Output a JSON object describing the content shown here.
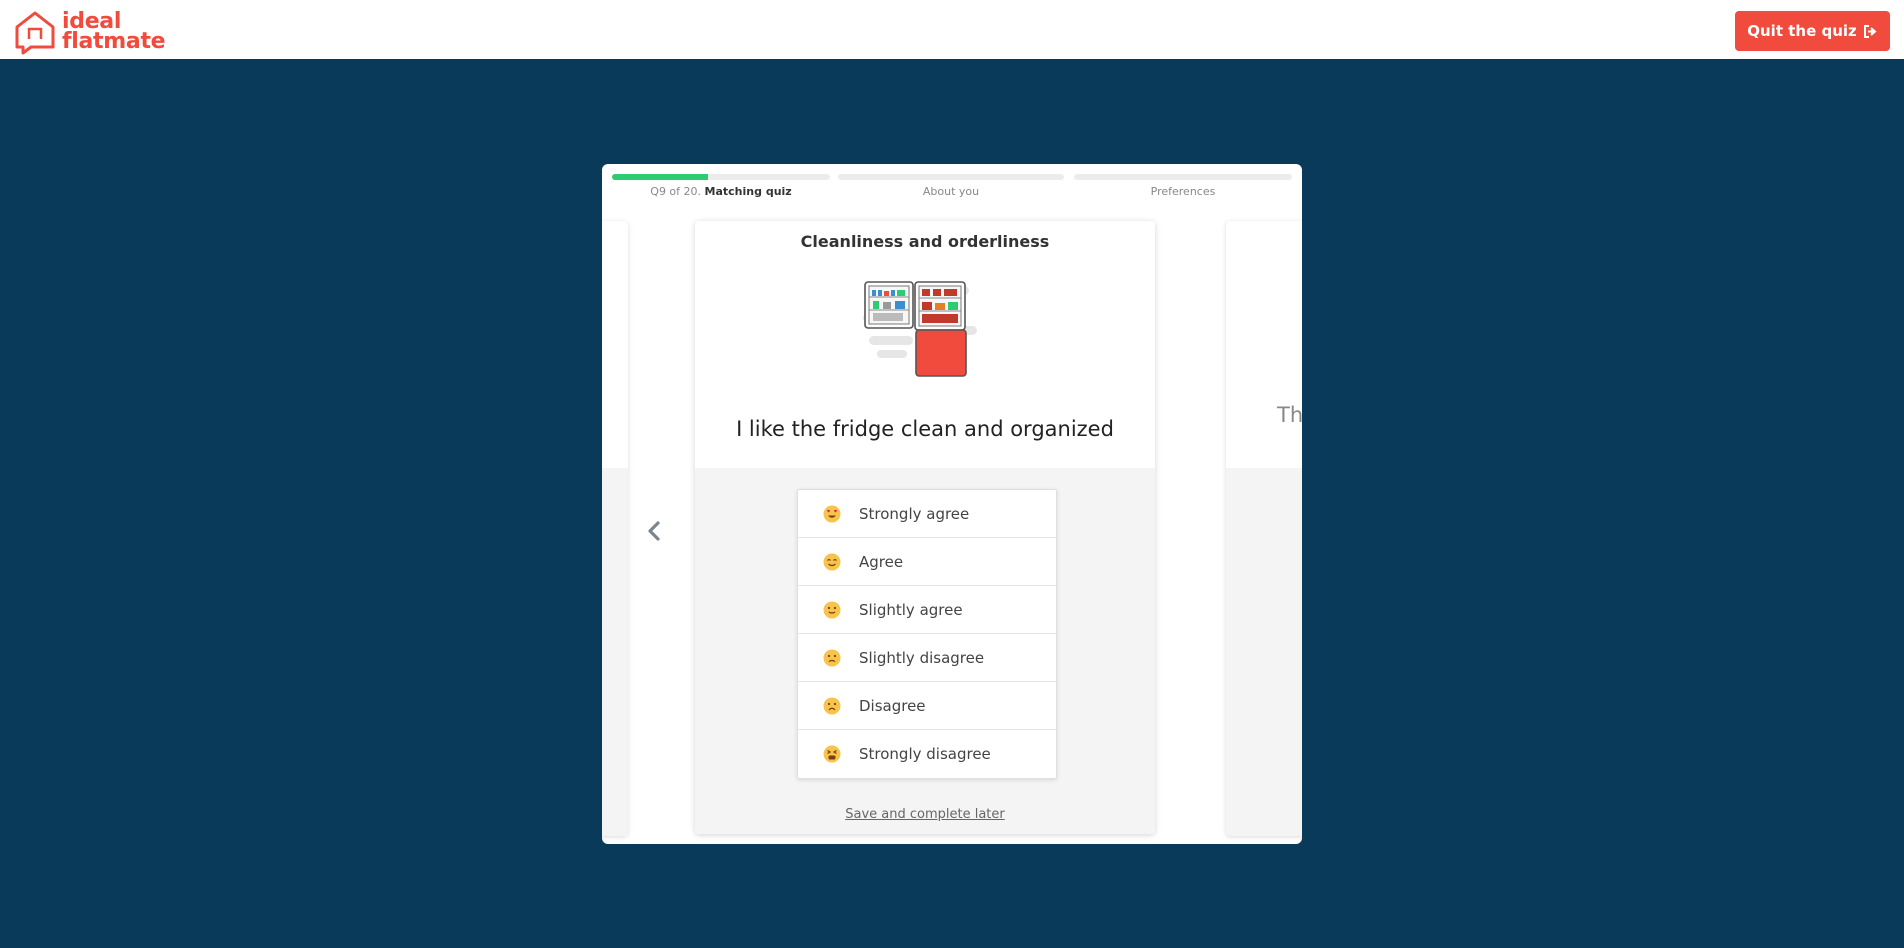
{
  "brand": {
    "line1": "ideal",
    "line2": "flatmate",
    "accent": "#f04b3c"
  },
  "header": {
    "quit_label": "Quit the quiz"
  },
  "progress": {
    "steps": [
      {
        "prefix": "Q9 of 20.",
        "label": "Matching quiz",
        "progress": 0.44
      },
      {
        "label": "About you",
        "progress": 0
      },
      {
        "label": "Preferences",
        "progress": 0
      }
    ]
  },
  "question": {
    "category": "Cleanliness and orderliness",
    "statement": "I like the fridge clean and organized",
    "illustration_icon": "fridge-illustration",
    "answers": [
      {
        "label": "Strongly agree",
        "icon": "heart-eyes-emoji"
      },
      {
        "label": "Agree",
        "icon": "smiling-emoji"
      },
      {
        "label": "Slightly agree",
        "icon": "slight-smile-emoji"
      },
      {
        "label": "Slightly disagree",
        "icon": "slight-frown-emoji"
      },
      {
        "label": "Disagree",
        "icon": "frown-emoji"
      },
      {
        "label": "Strongly disagree",
        "icon": "tired-face-emoji"
      }
    ],
    "save_label": "Save and complete later"
  },
  "next_card_peek": "The",
  "colors": {
    "background": "#0a3a5a",
    "progress_fill": "#2ecc71",
    "emoji": "#f7c34a"
  }
}
